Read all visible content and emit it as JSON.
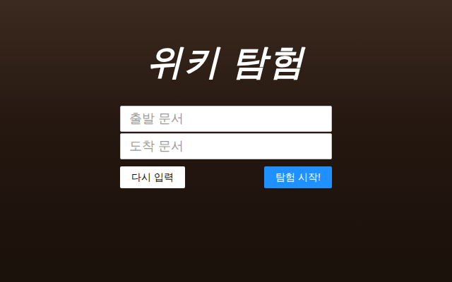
{
  "title": "위키 탐험",
  "fields": [
    {
      "placeholder": "출발 문서"
    },
    {
      "placeholder": "도착 문서"
    }
  ],
  "buttons": [
    {
      "label": "다시 입력",
      "kind": "secondary"
    },
    {
      "label": "탐험 시작!",
      "kind": "primary"
    }
  ]
}
